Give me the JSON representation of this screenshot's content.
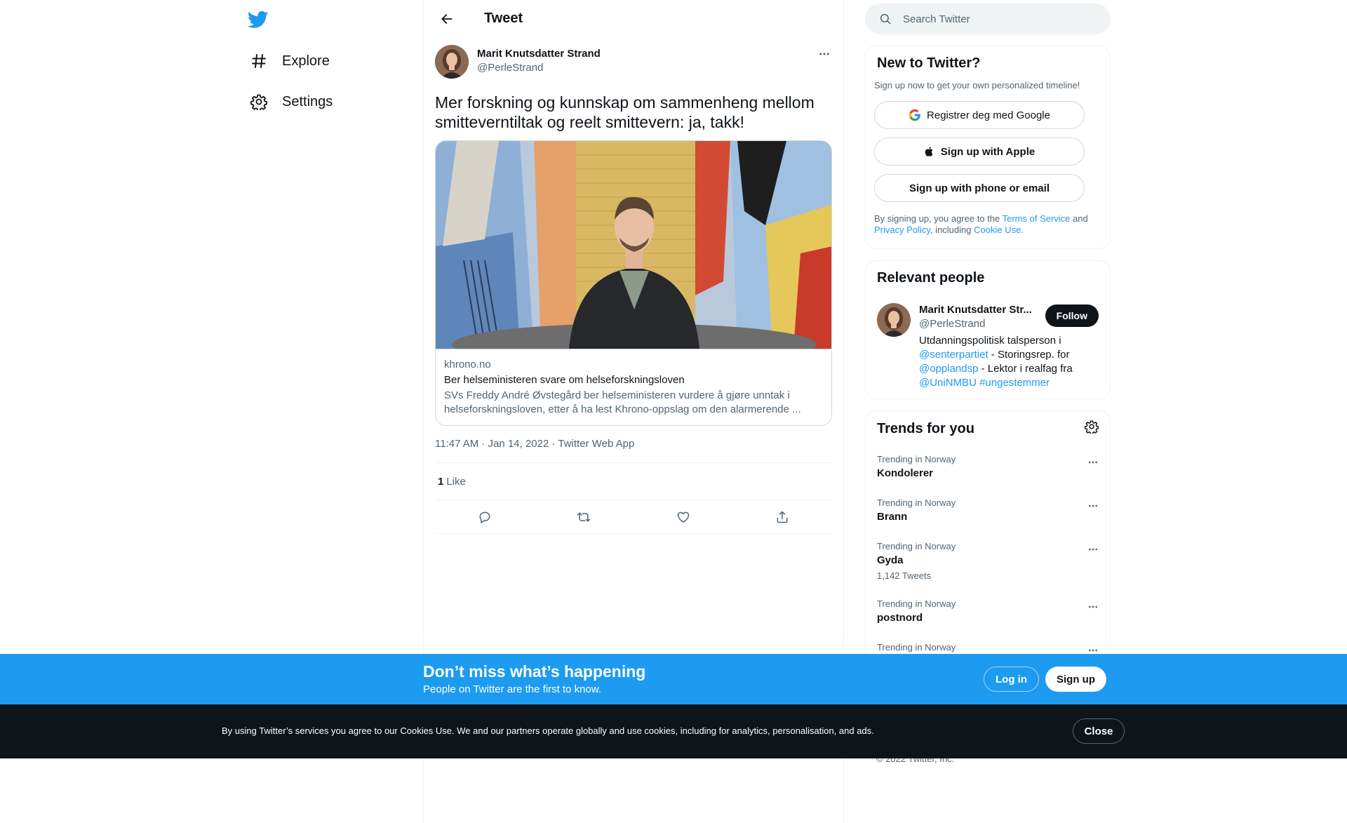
{
  "colors": {
    "brand": "#1d9bf0",
    "text": "#0f1419",
    "muted": "#536471",
    "dark": "#0f1419"
  },
  "nav": {
    "logo_icon": "twitter-bird-icon",
    "items": [
      {
        "label": "Explore",
        "icon": "hashtag-icon"
      },
      {
        "label": "Settings",
        "icon": "gear-icon"
      }
    ]
  },
  "header": {
    "title": "Tweet",
    "back_icon": "arrow-left-icon"
  },
  "tweet": {
    "author_name": "Marit Knutsdatter Strand",
    "author_handle": "@PerleStrand",
    "text": "Mer forskning og kunnskap om sammenheng mellom smitteverntiltak og reelt smittevern: ja, takk!",
    "card": {
      "domain": "khrono.no",
      "title": "Ber helseministeren svare om helseforskningsloven",
      "description": "SVs Freddy André Øvstegård ber helseministeren vurdere å gjøre unntak i helseforskningsloven, etter å ha lest Khrono-oppslag om den alarmerende ..."
    },
    "timestamp": "11:47 AM · Jan 14, 2022 · Twitter Web App",
    "likes_count": "1",
    "likes_label": "Like"
  },
  "search": {
    "placeholder": "Search Twitter"
  },
  "signup_panel": {
    "title": "New to Twitter?",
    "subtitle": "Sign up now to get your own personalized timeline!",
    "google_label": "Registrer deg med Google",
    "apple_label": "Sign up with Apple",
    "phone_label": "Sign up with phone or email",
    "legal_prefix": "By signing up, you agree to the ",
    "terms": "Terms of Service",
    "and": " and",
    "privacy": "Privacy Policy",
    "including": ", including ",
    "cookie": "Cookie Use."
  },
  "relevant": {
    "title": "Relevant people",
    "name": "Marit Knutsdatter Str...",
    "handle": "@PerleStrand",
    "follow": "Follow",
    "bio_1": "Utdanningspolitisk talsperson i ",
    "bio_link_1": "@senterpartiet",
    "bio_2": " - Storingsrep. for ",
    "bio_link_2": "@opplandsp",
    "bio_3": " - Lektor i realfag fra ",
    "bio_link_3": "@UniNMBU",
    "bio_link_4": "#ungestemmer"
  },
  "trends": {
    "title": "Trends for you",
    "items": [
      {
        "context": "Trending in Norway",
        "name": "Kondolerer",
        "count": ""
      },
      {
        "context": "Trending in Norway",
        "name": "Brann",
        "count": ""
      },
      {
        "context": "Trending in Norway",
        "name": "Gyda",
        "count": "1,142 Tweets"
      },
      {
        "context": "Trending in Norway",
        "name": "postnord",
        "count": ""
      },
      {
        "context": "Trending in Norway",
        "name": "",
        "count": ""
      }
    ]
  },
  "copyright": "© 2022 Twitter, Inc.",
  "banner": {
    "title": "Don’t miss what’s happening",
    "subtitle": "People on Twitter are the first to know.",
    "login": "Log in",
    "signup": "Sign up"
  },
  "cookie_bar": {
    "text": "By using Twitter’s services you agree to our Cookies Use. We and our partners operate globally and use cookies, including for analytics, personalisation, and ads.",
    "close": "Close"
  }
}
